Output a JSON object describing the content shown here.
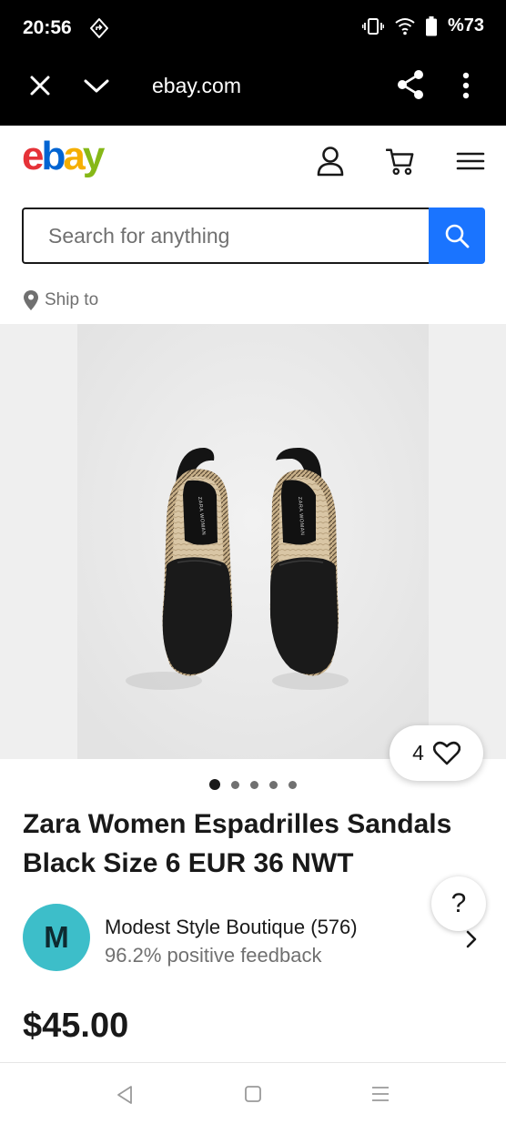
{
  "status_bar": {
    "time": "20:56",
    "battery": "%73"
  },
  "browser": {
    "url": "ebay.com"
  },
  "header": {
    "logo_letters": [
      "e",
      "b",
      "a",
      "y"
    ],
    "logo_colors": [
      "#e53238",
      "#0064d2",
      "#f5af02",
      "#86b817"
    ]
  },
  "search": {
    "placeholder": "Search for anything",
    "value": ""
  },
  "ship_to": {
    "label": "Ship to"
  },
  "product": {
    "watch_count": "4",
    "image_count": 5,
    "active_image": 1,
    "title": "Zara Women Espadrilles Sandals Black Size 6 EUR 36 NWT",
    "price": "$45.00",
    "insole_label": "ZARA WOMAN"
  },
  "seller": {
    "initial": "M",
    "name": "Modest Style Boutique (576)",
    "feedback": "96.2% positive feedback",
    "avatar_color": "#3dbec9"
  },
  "help": {
    "label": "?"
  },
  "colors": {
    "search_button": "#1a74ff",
    "text_primary": "#191919",
    "text_secondary": "#707070"
  }
}
